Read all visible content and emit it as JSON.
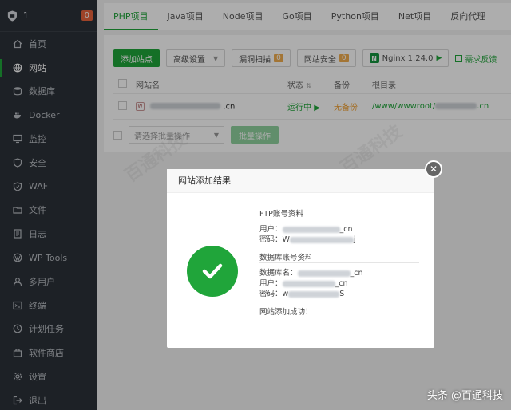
{
  "brand": {
    "name": "1",
    "badge": "0"
  },
  "sidebar": {
    "items": [
      {
        "label": "首页",
        "icon": "home-icon"
      },
      {
        "label": "网站",
        "icon": "globe-icon",
        "active": true
      },
      {
        "label": "数据库",
        "icon": "database-icon"
      },
      {
        "label": "Docker",
        "icon": "docker-icon"
      },
      {
        "label": "监控",
        "icon": "monitor-icon"
      },
      {
        "label": "安全",
        "icon": "shield-icon"
      },
      {
        "label": "WAF",
        "icon": "waf-icon"
      },
      {
        "label": "文件",
        "icon": "folder-icon"
      },
      {
        "label": "日志",
        "icon": "log-icon"
      },
      {
        "label": "WP Tools",
        "icon": "wordpress-icon"
      },
      {
        "label": "多用户",
        "icon": "users-icon"
      },
      {
        "label": "终端",
        "icon": "terminal-icon"
      },
      {
        "label": "计划任务",
        "icon": "clock-icon"
      },
      {
        "label": "软件商店",
        "icon": "store-icon"
      },
      {
        "label": "设置",
        "icon": "gear-icon"
      },
      {
        "label": "退出",
        "icon": "logout-icon"
      }
    ]
  },
  "tabs": [
    "PHP项目",
    "Java项目",
    "Node项目",
    "Go项目",
    "Python项目",
    "Net项目",
    "反向代理"
  ],
  "toolbar": {
    "add_site": "添加站点",
    "advanced": "高级设置",
    "vuln_scan": "漏洞扫描",
    "vuln_count": "0",
    "site_security": "网站安全",
    "security_count": "0",
    "nginx": "Nginx 1.24.0",
    "feedback": "需求反馈"
  },
  "table": {
    "headers": {
      "name": "网站名",
      "status": "状态",
      "backup": "备份",
      "root": "根目录"
    },
    "rows": [
      {
        "name_suffix": ".cn",
        "status": "运行中",
        "backup": "无备份",
        "root_prefix": "/www/wwwroot/",
        "root_suffix": ".cn"
      }
    ]
  },
  "batch": {
    "select_placeholder": "请选择批量操作",
    "button": "批量操作"
  },
  "modal": {
    "title": "网站添加结果",
    "ftp_title": "FTP账号资料",
    "ftp_user_label": "用户：",
    "ftp_user_end": "_cn",
    "ftp_pass_label": "密码：",
    "ftp_pass_start": "W",
    "ftp_pass_end": "j",
    "db_title": "数据库账号资料",
    "db_name_label": "数据库名：",
    "db_name_end": "_cn",
    "db_user_label": "用户：",
    "db_user_end": "_cn",
    "db_pass_label": "密码：",
    "db_pass_start": "w",
    "db_pass_end": "S",
    "success": "网站添加成功！"
  },
  "watermark": "百通科技",
  "credit": "头条 @百通科技",
  "colors": {
    "accent": "#20a53a",
    "sidebar": "#2c3138",
    "badge": "#e9643b"
  }
}
